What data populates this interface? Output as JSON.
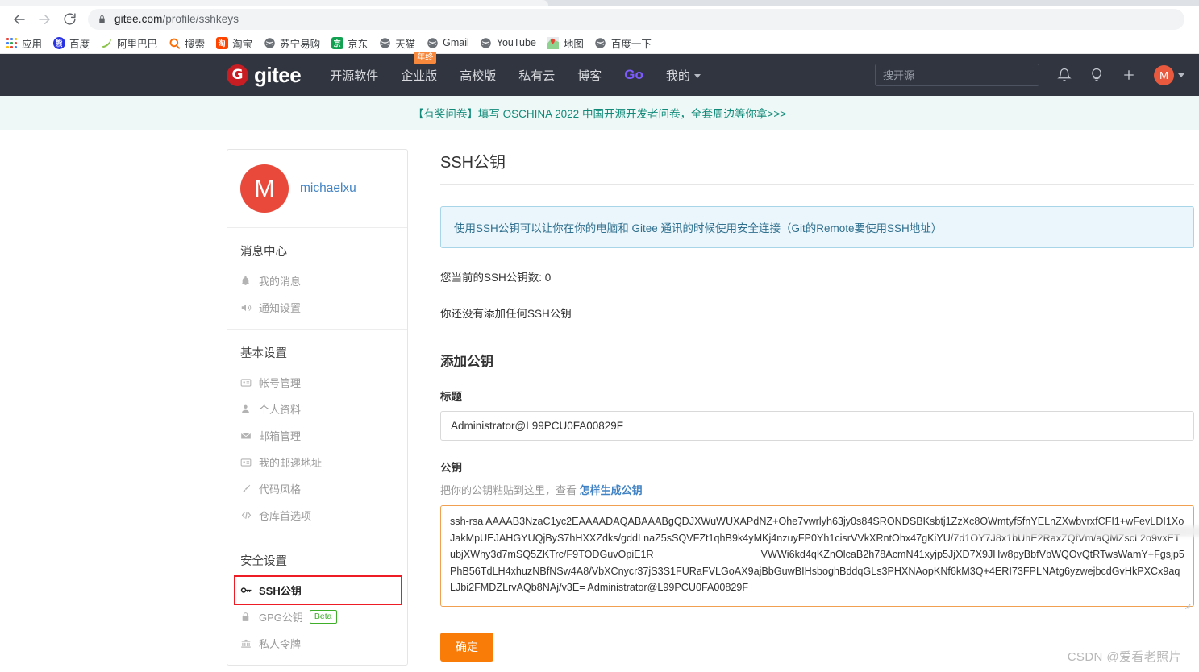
{
  "browser": {
    "back_icon": "back-arrow-icon",
    "forward_icon": "forward-arrow-icon",
    "reload_icon": "reload-icon",
    "lock_icon": "lock-icon",
    "url_host": "gitee.com",
    "url_path": "/profile/sshkeys",
    "bookmarks": [
      {
        "label": "应用",
        "icon": "apps-grid-icon",
        "color": "#4285f4"
      },
      {
        "label": "百度",
        "icon": "baidu-icon",
        "color": "#2932e1"
      },
      {
        "label": "阿里巴巴",
        "icon": "alibaba-leaf-icon",
        "color": "#8bc34a"
      },
      {
        "label": "搜索",
        "icon": "search-globe-icon",
        "color": "#ff6a00"
      },
      {
        "label": "淘宝",
        "icon": "taobao-icon",
        "color": "#ff4400"
      },
      {
        "label": "苏宁易购",
        "icon": "globe-icon",
        "color": "#6b7076"
      },
      {
        "label": "京东",
        "icon": "jd-icon",
        "color": "#12a150"
      },
      {
        "label": "天猫",
        "icon": "globe-icon",
        "color": "#6b7076"
      },
      {
        "label": "Gmail",
        "icon": "globe-icon",
        "color": "#6b7076"
      },
      {
        "label": "YouTube",
        "icon": "globe-icon",
        "color": "#6b7076"
      },
      {
        "label": "地图",
        "icon": "maps-pin-icon",
        "color": "#34a853"
      },
      {
        "label": "百度一下",
        "icon": "globe-icon",
        "color": "#6b7076"
      }
    ]
  },
  "navbar": {
    "logo_letter": "G",
    "logo_text": "gitee",
    "links": [
      {
        "label": "开源软件",
        "badge": ""
      },
      {
        "label": "企业版",
        "badge": "年终"
      },
      {
        "label": "高校版",
        "badge": ""
      },
      {
        "label": "私有云",
        "badge": ""
      },
      {
        "label": "博客",
        "badge": ""
      },
      {
        "label": "Go",
        "badge": ""
      },
      {
        "label": "我的",
        "badge": ""
      }
    ],
    "search_placeholder": "搜开源",
    "bell_icon": "bell-icon",
    "bulb_icon": "lightbulb-icon",
    "plus_icon": "plus-icon",
    "avatar_letter": "M",
    "brand_color": "#c71d23",
    "bg_color": "#31353f"
  },
  "promo": {
    "text": "【有奖问卷】填写 OSCHINA 2022 中国开源开发者问卷，全套周边等你拿>>>",
    "color": "#128a79",
    "bg": "#eef8f6"
  },
  "sidebar": {
    "avatar_letter": "M",
    "username": "michaelxu",
    "sections": [
      {
        "title": "消息中心",
        "items": [
          {
            "label": "我的消息",
            "icon": "bell-icon",
            "active": false,
            "highlighted": false,
            "tag": ""
          },
          {
            "label": "通知设置",
            "icon": "speaker-icon",
            "active": false,
            "highlighted": false,
            "tag": ""
          }
        ]
      },
      {
        "title": "基本设置",
        "items": [
          {
            "label": "帐号管理",
            "icon": "id-card-icon",
            "active": false,
            "highlighted": false,
            "tag": ""
          },
          {
            "label": "个人资料",
            "icon": "user-icon",
            "active": false,
            "highlighted": false,
            "tag": ""
          },
          {
            "label": "邮箱管理",
            "icon": "envelope-icon",
            "active": false,
            "highlighted": false,
            "tag": ""
          },
          {
            "label": "我的邮递地址",
            "icon": "id-card-icon",
            "active": false,
            "highlighted": false,
            "tag": ""
          },
          {
            "label": "代码风格",
            "icon": "brush-icon",
            "active": false,
            "highlighted": false,
            "tag": ""
          },
          {
            "label": "仓库首选项",
            "icon": "code-icon",
            "active": false,
            "highlighted": false,
            "tag": ""
          }
        ]
      },
      {
        "title": "安全设置",
        "items": [
          {
            "label": "SSH公钥",
            "icon": "key-icon",
            "active": true,
            "highlighted": true,
            "tag": ""
          },
          {
            "label": "GPG公钥",
            "icon": "lock-icon",
            "active": false,
            "highlighted": false,
            "tag": "Beta"
          },
          {
            "label": "私人令牌",
            "icon": "bank-icon",
            "active": false,
            "highlighted": false,
            "tag": ""
          }
        ]
      }
    ],
    "highlight_color": "#ee1c25"
  },
  "main": {
    "page_title": "SSH公钥",
    "info_text": "使用SSH公钥可以让你在你的电脑和 Gitee 通讯的时候使用安全连接（Git的Remote要使用SSH地址）",
    "key_count_text": "您当前的SSH公钥数: 0",
    "empty_text": "你还没有添加任何SSH公钥",
    "add_title": "添加公钥",
    "title_label": "标题",
    "title_value": "Administrator@L99PCU0FA00829F",
    "key_label": "公钥",
    "key_hint_prefix": "把你的公钥粘贴到这里，查看 ",
    "key_hint_link": "怎样生成公钥",
    "key_value": "ssh-rsa AAAAB3NzaC1yc2EAAAADAQABAAABgQDJXWuWUXAPdNZ+Ohe7vwrlyh63jy0s84SRONDSBKsbtj1ZzXc8OWmtyf5fnYELnZXwbvrxfCFI1+wFevLDI1XoJakMpUEJAHGYUQjByS7hHXXZdks/gddLnaZ5sSQVFZt1qhB9k4yMKj4nzuyFP0Yh1cisrVVkXRntOhx47gKiYU/7d1OY7J8x1bUhE2RaxZQfVm/aQMZscL2o9vxETubjXWhy3d7mSQ5ZKTrc/F9TODGuvOpiE1R                                      VWWi6kd4qKZnOlcaB2h78AcmN41xyjp5JjXD7X9JHw8pyBbfVbWQOvQtRTwsWamY+Fgsjp5PhB56TdLH4xhuzNBfNSw4A8/VbXCnycr37jS3S1FURaFVLGoAX9ajBbGuwBIHsboghBddqGLs3PHXNAopKNf6kM3Q+4ERI73FPLNAtg6yzwejbcdGvHkPXCx9aqLJbi2FMDZLrvAQb8NAj/v3E= Administrator@L99PCU0FA00829F",
    "submit_label": "确定",
    "accent_color": "#fa7c08",
    "info_bg": "#eaf6fb",
    "info_border": "#a8d5e8",
    "link_color": "#4183c4"
  },
  "watermark": {
    "text": "CSDN @爱看老照片"
  }
}
